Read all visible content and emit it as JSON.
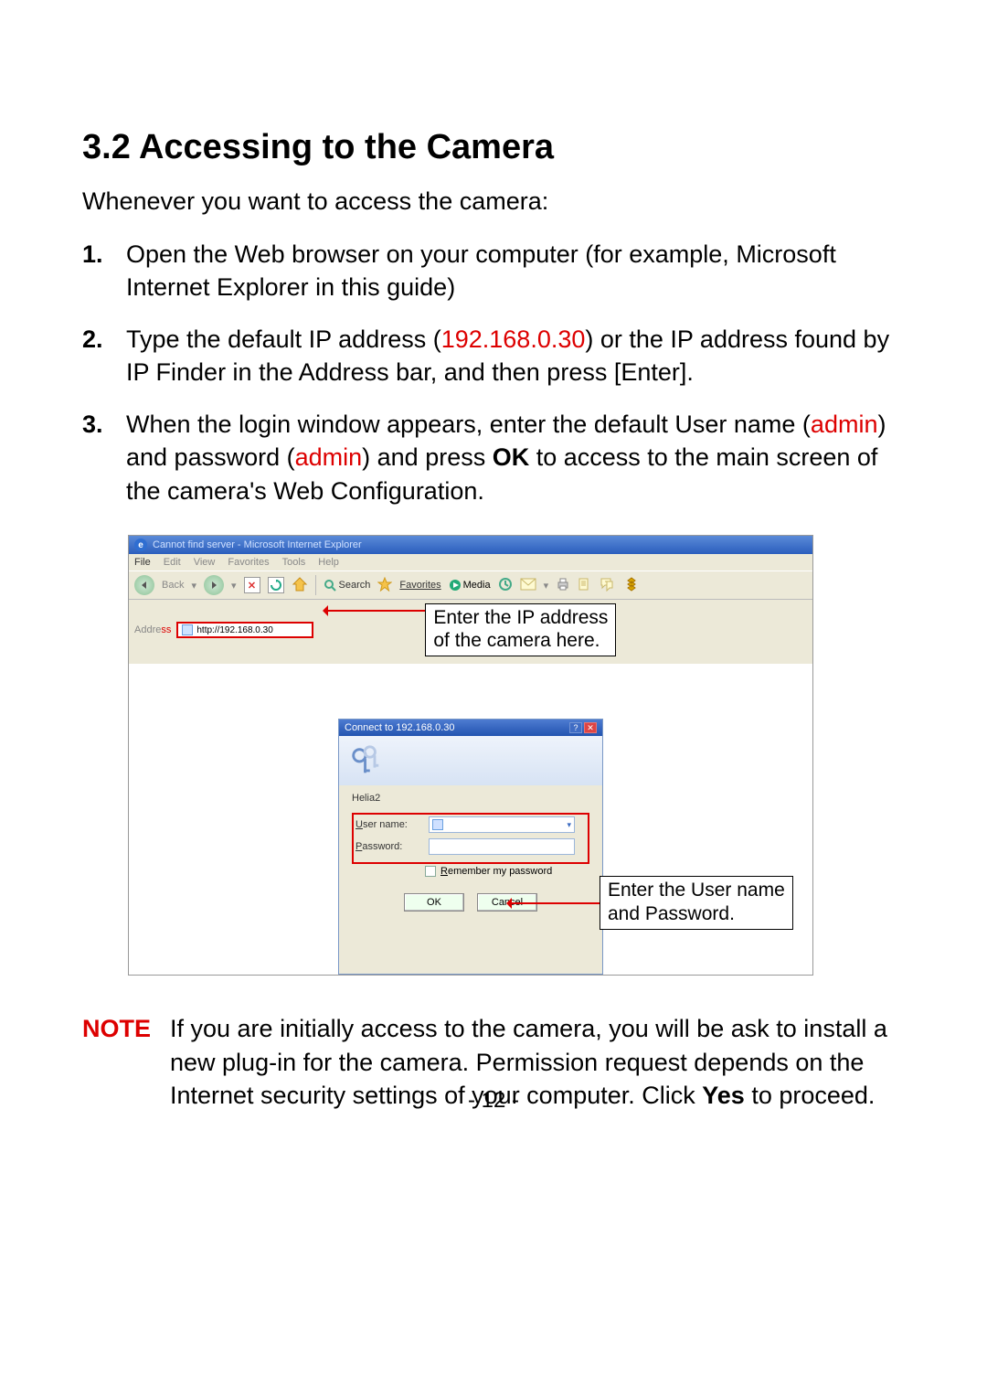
{
  "section": {
    "heading": "3.2  Accessing to the Camera"
  },
  "intro": "Whenever you want to access the camera:",
  "steps": [
    {
      "num": "1.",
      "pre": "Open the Web browser on your computer (for example, Microsoft Internet Explorer in this guide)"
    },
    {
      "num": "2.",
      "pre": "Type the default IP address (",
      "red": "192.168.0.30",
      "post": ") or the IP address found by IP Finder in the Address bar, and then press [Enter]."
    },
    {
      "num": "3.",
      "pre": "When the login window appears, enter the default User name (",
      "red1": "admin",
      "mid": ") and password (",
      "red2": "admin",
      "post": ") and press ",
      "bold": "OK",
      "tail": " to access to the main screen of the camera's Web Configuration."
    }
  ],
  "ie": {
    "title": "Cannot find server - Microsoft Internet Explorer",
    "menu": [
      "File",
      "Edit",
      "View",
      "Favorites",
      "Tools",
      "Help"
    ],
    "toolbar": {
      "back": "Back",
      "search": "Search",
      "favorites": "Favorites",
      "media": "Media"
    },
    "address_label": "Address",
    "address_value": "http://192.168.0.30"
  },
  "callout_addr_l1": "Enter the IP address",
  "callout_addr_l2": "of the camera here.",
  "dialog": {
    "title": "Connect to 192.168.0.30",
    "server": "Helia2",
    "user_label": "User name:",
    "pass_label": "Password:",
    "remember": "Remember my password",
    "ok": "OK",
    "cancel": "Cancel"
  },
  "callout_cred_l1": "Enter the User name",
  "callout_cred_l2": "and Password.",
  "note": {
    "label": "NOTE",
    "body_pre": "If you are initially access to the camera, you will be ask to install a new plug-in for the camera. Permission request depends on the Internet security settings of your computer. Click ",
    "bold": "Yes",
    "body_post": " to proceed."
  },
  "page_number": "- 12 -"
}
